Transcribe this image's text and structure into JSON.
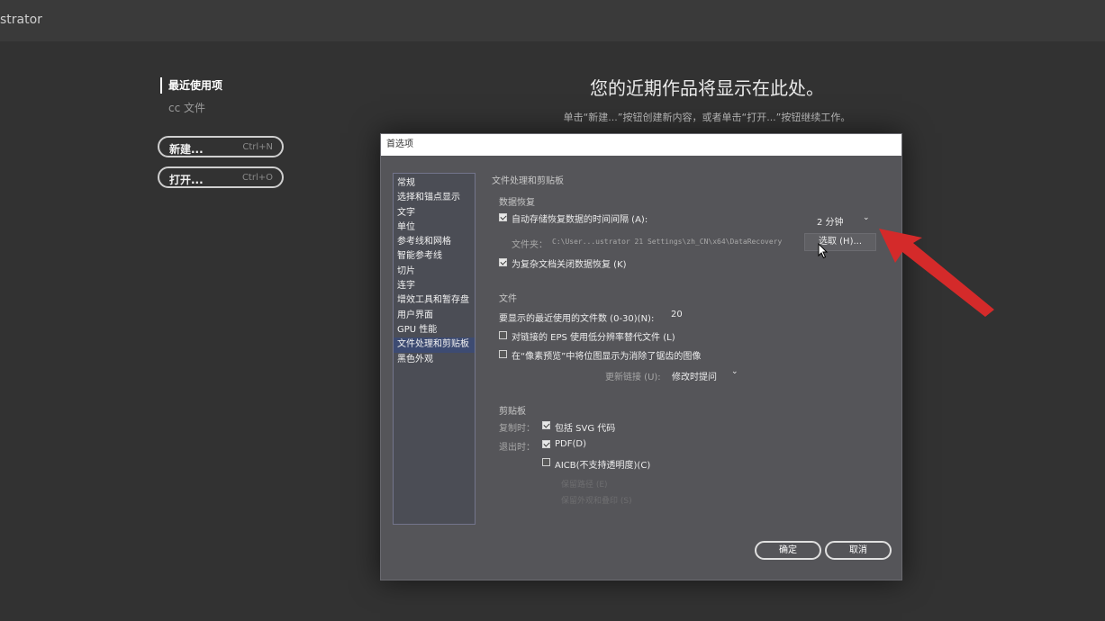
{
  "app": {
    "title_fragment": "strator"
  },
  "home": {
    "nav": {
      "active": "最近使用项",
      "item": "cc 文件"
    },
    "buttons": [
      {
        "label": "新建...",
        "shortcut": "Ctrl+N"
      },
      {
        "label": "打开...",
        "shortcut": "Ctrl+O"
      }
    ],
    "hero_title": "您的近期作品将显示在此处。",
    "hero_subtitle": "单击“新建...”按钮创建新内容，或者单击“打开...”按钮继续工作。"
  },
  "dialog": {
    "title": "首选项",
    "categories": [
      "常规",
      "选择和锚点显示",
      "文字",
      "单位",
      "参考线和网格",
      "智能参考线",
      "切片",
      "连字",
      "增效工具和暂存盘",
      "用户界面",
      "GPU 性能",
      "文件处理和剪贴板",
      "黑色外观"
    ],
    "selected_category_index": 11,
    "section_title": "文件处理和剪贴板",
    "data_recovery": {
      "title": "数据恢复",
      "autosave_label": "自动存储恢复数据的时间间隔 (A):",
      "autosave_checked": true,
      "interval_value": "2 分钟",
      "folder_label": "文件夹：",
      "folder_path": "C:\\User...ustrator 21 Settings\\zh_CN\\x64\\DataRecovery",
      "choose_button": "选取 (H)...",
      "complex_label": "为复杂文档关闭数据恢复 (K)",
      "complex_checked": true
    },
    "files": {
      "title": "文件",
      "recent_count_label": "要显示的最近使用的文件数 (0-30)(N):",
      "recent_count_value": "20",
      "eps_label": "对链接的 EPS 使用低分辨率替代文件 (L)",
      "eps_checked": false,
      "pixel_preview_label": "在“像素预览”中将位图显示为消除了锯齿的图像",
      "pixel_preview_checked": false,
      "update_links_label": "更新链接 (U):",
      "update_links_value": "修改时提问"
    },
    "clipboard": {
      "title": "剪贴板",
      "copy_label": "复制时：",
      "svg_label": "包括 SVG 代码",
      "svg_checked": true,
      "exit_label": "退出时：",
      "pdf_label": "PDF(D)",
      "pdf_checked": true,
      "aicb_label": "AICB(不支持透明度)(C)",
      "aicb_checked": false,
      "faded_1": "保留路径 (E)",
      "faded_2": "保留外观和叠印 (S)"
    },
    "ok_label": "确定",
    "cancel_label": "取消"
  },
  "colors": {
    "background": "#323232",
    "dialog_bg": "#555559",
    "selection": "#3d4b72",
    "annotation_arrow": "#d42a2a"
  }
}
